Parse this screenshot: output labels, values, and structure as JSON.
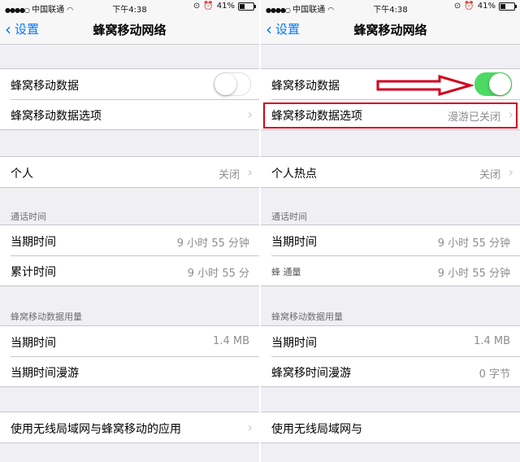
{
  "status": {
    "carrier": "中国联通",
    "time": "下午4:38",
    "battery": "41%"
  },
  "nav": {
    "back": "设置",
    "title": "蜂窝移动网络"
  },
  "left": {
    "cellular_data": "蜂窝移动数据",
    "cellular_options": "蜂窝移动数据选项",
    "hotspot_label": "个人",
    "hotspot_value": "关闭",
    "call_time_header": "通话时间",
    "current_period": "当期时间",
    "current_period_value": "9 小时 55 分钟",
    "lifetime": "累计时间",
    "lifetime_value": "9 小时 55 分",
    "usage_header": "蜂窝移动数据用量",
    "usage_current": "当期时间",
    "usage_current_value": "1.4 MB",
    "usage_roaming": "当期时间漫游",
    "wlan_assist": "使用无线局域网与蜂窝移动的应用"
  },
  "right": {
    "cellular_data": "蜂窝移动数据",
    "cellular_options": "蜂窝移动数据选项",
    "cellular_options_value": "漫游已关闭",
    "hotspot_label": "个人热点",
    "hotspot_value": "关闭",
    "call_time_header": "通话时间",
    "current_period": "当期时间",
    "current_period_value": "9 小时 55 分钟",
    "lifetime_value": "9 小时 55 分钟",
    "lifetime_overlay": "蜂 通量",
    "usage_header": "蜂窝移动数据用量",
    "usage_current": "当期时间",
    "usage_current_value": "1.4 MB",
    "usage_roaming": "蜂窝移时间漫游",
    "usage_roaming_value": "0 字节",
    "wlan_assist": "使用无线局域网与"
  },
  "colors": {
    "accent": "#007aff",
    "toggle_on": "#4cd964",
    "annotation_red": "#d0021b"
  },
  "toggles": {
    "left_cellular_data_on": false,
    "right_cellular_data_on": true
  }
}
